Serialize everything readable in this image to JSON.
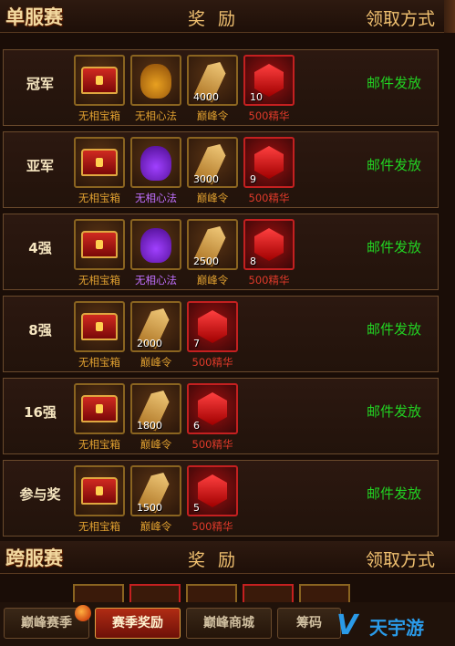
{
  "single_server": {
    "title": "单服赛",
    "reward_header": "奖 励",
    "claim_header": "领取方式"
  },
  "cross_server": {
    "title": "跨服赛",
    "reward_header": "奖 励",
    "claim_header": "领取方式"
  },
  "rows": [
    {
      "rank": "冠军",
      "claim": "邮件发放",
      "items": [
        {
          "icon": "chest-icon",
          "label": "无相宝箱",
          "qty": ""
        },
        {
          "icon": "gold-bag-icon",
          "label": "无相心法",
          "qty": ""
        },
        {
          "icon": "token-icon",
          "label": "巅峰令",
          "qty": "4000"
        },
        {
          "icon": "red-gem-icon",
          "label": "500精华",
          "qty": "10"
        }
      ]
    },
    {
      "rank": "亚军",
      "claim": "邮件发放",
      "items": [
        {
          "icon": "chest-icon",
          "label": "无相宝箱",
          "qty": ""
        },
        {
          "icon": "purple-bag-icon",
          "label": "无相心法",
          "qty": ""
        },
        {
          "icon": "token-icon",
          "label": "巅峰令",
          "qty": "3000"
        },
        {
          "icon": "red-gem-icon",
          "label": "500精华",
          "qty": "9"
        }
      ]
    },
    {
      "rank": "4强",
      "claim": "邮件发放",
      "items": [
        {
          "icon": "chest-icon",
          "label": "无相宝箱",
          "qty": ""
        },
        {
          "icon": "purple-bag-icon",
          "label": "无相心法",
          "qty": ""
        },
        {
          "icon": "token-icon",
          "label": "巅峰令",
          "qty": "2500"
        },
        {
          "icon": "red-gem-icon",
          "label": "500精华",
          "qty": "8"
        }
      ]
    },
    {
      "rank": "8强",
      "claim": "邮件发放",
      "items": [
        {
          "icon": "chest-icon",
          "label": "无相宝箱",
          "qty": ""
        },
        {
          "icon": "token-icon",
          "label": "巅峰令",
          "qty": "2000"
        },
        {
          "icon": "red-gem-icon",
          "label": "500精华",
          "qty": "7"
        }
      ]
    },
    {
      "rank": "16强",
      "claim": "邮件发放",
      "items": [
        {
          "icon": "chest-icon",
          "label": "无相宝箱",
          "qty": ""
        },
        {
          "icon": "token-icon",
          "label": "巅峰令",
          "qty": "1800"
        },
        {
          "icon": "red-gem-icon",
          "label": "500精华",
          "qty": "6"
        }
      ]
    },
    {
      "rank": "参与奖",
      "claim": "邮件发放",
      "items": [
        {
          "icon": "chest-icon",
          "label": "无相宝箱",
          "qty": ""
        },
        {
          "icon": "token-icon",
          "label": "巅峰令",
          "qty": "1500"
        },
        {
          "icon": "red-gem-icon",
          "label": "500精华",
          "qty": "5"
        }
      ]
    }
  ],
  "tabs": [
    {
      "label": "巅峰赛季",
      "active": false
    },
    {
      "label": "赛季奖励",
      "active": true
    },
    {
      "label": "巅峰商城",
      "active": false
    },
    {
      "label": "筹码",
      "active": false
    }
  ],
  "watermark": {
    "text": "天宇游"
  }
}
